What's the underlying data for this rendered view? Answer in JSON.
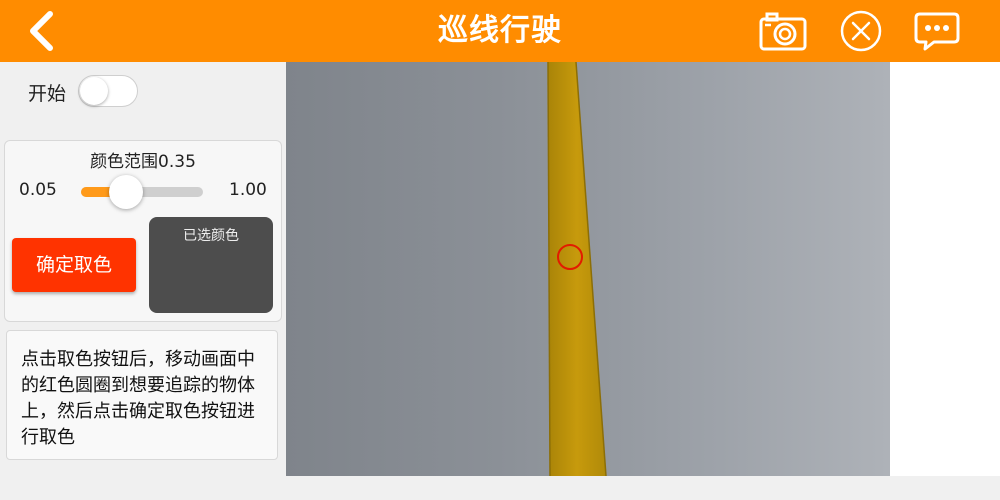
{
  "header": {
    "title": "巡线行驶",
    "background_color": "#ff8c00",
    "back_icon": "chevron-left-icon",
    "right_icons": [
      "camera-icon",
      "close-circle-icon",
      "chat-bubble-icon"
    ]
  },
  "controls": {
    "start_label": "开始",
    "start_toggle_on": false
  },
  "color_range": {
    "title": "颜色范围0.35",
    "min_label": "0.05",
    "max_label": "1.00",
    "min": 0.05,
    "max": 1.0,
    "value": 0.35,
    "fill_color": "#ff9a1a"
  },
  "confirm_button": {
    "label": "确定取色",
    "color": "#ff3300"
  },
  "selected_color": {
    "label": "已选颜色",
    "swatch_color": "#4d4d4d"
  },
  "hint": {
    "text": "点击取色按钮后，移动画面中的红色圆圈到想要追踪的物体上，然后点击确定取色按钮进行取色"
  },
  "camera": {
    "tape_color": "#c79a0c",
    "target_ring_color": "#e21b00"
  }
}
